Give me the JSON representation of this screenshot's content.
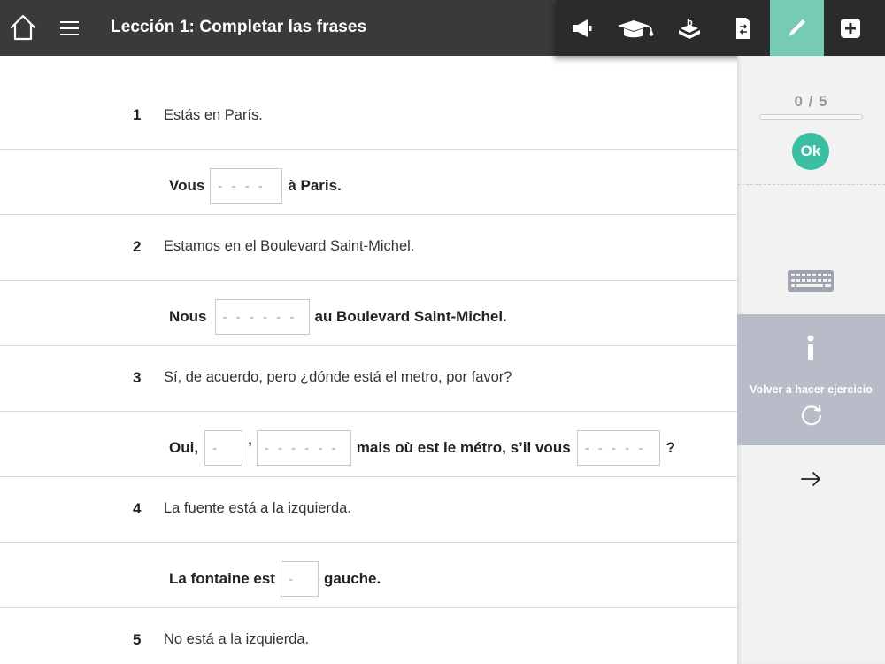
{
  "header": {
    "title": "Lección 1: Completar las frases"
  },
  "toolbar": {
    "tools": [
      {
        "name": "speaker-icon"
      },
      {
        "name": "graduation-cap-icon"
      },
      {
        "name": "hand-book-icon"
      },
      {
        "name": "document-arrows-icon"
      },
      {
        "name": "pencil-icon",
        "active": true
      },
      {
        "name": "plus-icon"
      }
    ],
    "active_color": "#76cbb4"
  },
  "exercise": {
    "items": [
      {
        "number": "1",
        "question": "Estás en París.",
        "answer": {
          "before": "Vous",
          "blank1": "- - - -",
          "after": "à Paris."
        }
      },
      {
        "number": "2",
        "question": "Estamos en el Boulevard Saint-Michel.",
        "answer": {
          "before": "Nous",
          "blank1": "- - - - - -",
          "after": "au Boulevard Saint-Michel."
        }
      },
      {
        "number": "3",
        "question": "Sí, de acuerdo, pero ¿dónde está el metro, por favor?",
        "answer": {
          "before": "Oui,",
          "blank1": "-",
          "apostrophe": "’",
          "blank2": "- - - - - -",
          "middle": "mais où est le métro, s’il vous",
          "blank3": "- - - - -",
          "after": "?"
        }
      },
      {
        "number": "4",
        "question": "La fuente está a la izquierda.",
        "answer": {
          "before": "La fontaine est",
          "blank1": "-",
          "after": "gauche."
        }
      },
      {
        "number": "5",
        "question": "No está a la izquierda."
      }
    ]
  },
  "sidepanel": {
    "score": "0 / 5",
    "progress": 0,
    "ok_label": "Ok",
    "retry_label": "Volver a hacer ejercicio",
    "accent_color": "#3bbfa3",
    "retry_bg_color": "#b7bcc8"
  }
}
